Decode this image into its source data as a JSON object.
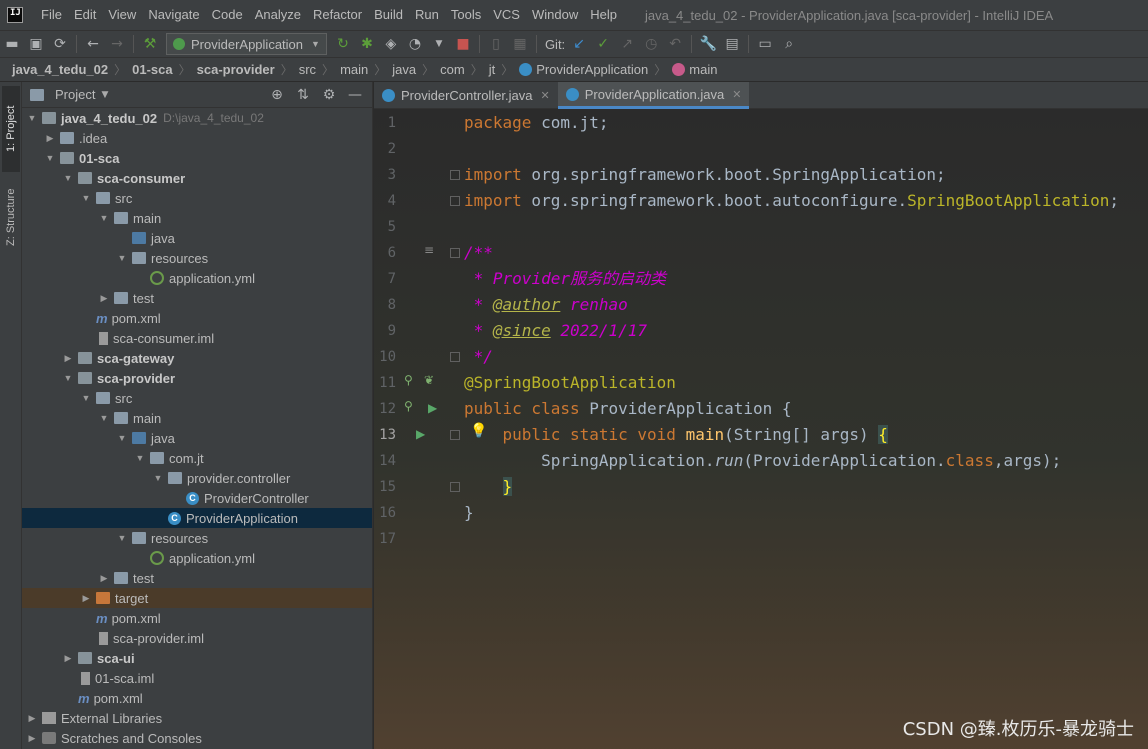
{
  "menu": {
    "logo": "IJ",
    "items": [
      "File",
      "Edit",
      "View",
      "Navigate",
      "Code",
      "Analyze",
      "Refactor",
      "Build",
      "Run",
      "Tools",
      "VCS",
      "Window",
      "Help"
    ],
    "window_title": "java_4_tedu_02 - ProviderApplication.java [sca-provider] - IntelliJ IDEA"
  },
  "toolbar": {
    "run_config": "ProviderApplication",
    "git_label": "Git:"
  },
  "breadcrumb": [
    "java_4_tedu_02",
    "01-sca",
    "sca-provider",
    "src",
    "main",
    "java",
    "com",
    "jt",
    "ProviderApplication",
    "main"
  ],
  "stripe": {
    "project_tab": "1: Project",
    "structure_tab": "Z: Structure"
  },
  "project_panel": {
    "title": "Project",
    "tree": [
      {
        "label": "java_4_tedu_02",
        "hint": "D:\\java_4_tedu_02",
        "depth": 0,
        "arrow": "▼",
        "icon": "module",
        "bold": true
      },
      {
        "label": ".idea",
        "depth": 1,
        "arrow": "▶",
        "icon": "folder"
      },
      {
        "label": "01-sca",
        "depth": 1,
        "arrow": "▼",
        "icon": "module",
        "bold": true
      },
      {
        "label": "sca-consumer",
        "depth": 2,
        "arrow": "▼",
        "icon": "module",
        "bold": true
      },
      {
        "label": "src",
        "depth": 3,
        "arrow": "▼",
        "icon": "folder"
      },
      {
        "label": "main",
        "depth": 4,
        "arrow": "▼",
        "icon": "folder"
      },
      {
        "label": "java",
        "depth": 5,
        "arrow": "",
        "icon": "src"
      },
      {
        "label": "resources",
        "depth": 5,
        "arrow": "▼",
        "icon": "res"
      },
      {
        "label": "application.yml",
        "depth": 6,
        "arrow": "",
        "icon": "yml"
      },
      {
        "label": "test",
        "depth": 4,
        "arrow": "▶",
        "icon": "folder"
      },
      {
        "label": "pom.xml",
        "depth": 3,
        "arrow": "",
        "icon": "pom"
      },
      {
        "label": "sca-consumer.iml",
        "depth": 3,
        "arrow": "",
        "icon": "iml"
      },
      {
        "label": "sca-gateway",
        "depth": 2,
        "arrow": "▶",
        "icon": "module",
        "bold": true
      },
      {
        "label": "sca-provider",
        "depth": 2,
        "arrow": "▼",
        "icon": "module",
        "bold": true
      },
      {
        "label": "src",
        "depth": 3,
        "arrow": "▼",
        "icon": "folder"
      },
      {
        "label": "main",
        "depth": 4,
        "arrow": "▼",
        "icon": "folder"
      },
      {
        "label": "java",
        "depth": 5,
        "arrow": "▼",
        "icon": "src"
      },
      {
        "label": "com.jt",
        "depth": 6,
        "arrow": "▼",
        "icon": "pkg"
      },
      {
        "label": "provider.controller",
        "depth": 7,
        "arrow": "▼",
        "icon": "pkg"
      },
      {
        "label": "ProviderController",
        "depth": 8,
        "arrow": "",
        "icon": "class"
      },
      {
        "label": "ProviderApplication",
        "depth": 7,
        "arrow": "",
        "icon": "class",
        "selected": true
      },
      {
        "label": "resources",
        "depth": 5,
        "arrow": "▼",
        "icon": "res"
      },
      {
        "label": "application.yml",
        "depth": 6,
        "arrow": "",
        "icon": "yml"
      },
      {
        "label": "test",
        "depth": 4,
        "arrow": "▶",
        "icon": "folder"
      },
      {
        "label": "target",
        "depth": 3,
        "arrow": "▶",
        "icon": "target",
        "target": true
      },
      {
        "label": "pom.xml",
        "depth": 3,
        "arrow": "",
        "icon": "pom"
      },
      {
        "label": "sca-provider.iml",
        "depth": 3,
        "arrow": "",
        "icon": "iml"
      },
      {
        "label": "sca-ui",
        "depth": 2,
        "arrow": "▶",
        "icon": "module",
        "bold": true
      },
      {
        "label": "01-sca.iml",
        "depth": 2,
        "arrow": "",
        "icon": "iml"
      },
      {
        "label": "pom.xml",
        "depth": 2,
        "arrow": "",
        "icon": "pom"
      },
      {
        "label": "External Libraries",
        "depth": 0,
        "arrow": "▶",
        "icon": "lib"
      },
      {
        "label": "Scratches and Consoles",
        "depth": 0,
        "arrow": "▶",
        "icon": "scratch"
      }
    ]
  },
  "editor_tabs": [
    {
      "label": "ProviderController.java",
      "active": false
    },
    {
      "label": "ProviderApplication.java",
      "active": true
    }
  ],
  "code": {
    "line_numbers": [
      "1",
      "2",
      "3",
      "4",
      "5",
      "6",
      "7",
      "8",
      "9",
      "10",
      "11",
      "12",
      "13",
      "14",
      "15",
      "16",
      "17"
    ],
    "current_line": "13",
    "l1_kw": "package",
    "l1_rest": " com.jt;",
    "l3_kw": "import",
    "l3_rest": " org.springframework.boot.SpringApplication;",
    "l4_kw": "import",
    "l4_rest": " org.springframework.boot.autoconfigure.",
    "l4_ann": "SpringBootApplication",
    "l4_end": ";",
    "l6": "/**",
    "l7_star": " * ",
    "l7_text": "Provider服务的启动类",
    "l8_star": " * ",
    "l8_tag": "@author",
    "l8_val": " renhao",
    "l9_star": " * ",
    "l9_tag": "@since",
    "l9_val": " 2022/1/17",
    "l10": " */",
    "l11": "@SpringBootApplication",
    "l12_kw": "public class",
    "l12_rest": " ProviderApplication {",
    "l13_indent": "    ",
    "l13_kw": "public static void",
    "l13_sp": " ",
    "l13_fn": "main",
    "l13_rest": "(String[] args) ",
    "l13_brace": "{",
    "l14_indent": "        ",
    "l14_a": "SpringApplication.",
    "l14_run": "run",
    "l14_b": "(ProviderApplication.",
    "l14_kw": "class",
    "l14_c": ",args);",
    "l15_indent": "    ",
    "l15_brace": "}",
    "l16": "}"
  },
  "watermark": "CSDN @臻.枚历乐-暴龙骑士"
}
